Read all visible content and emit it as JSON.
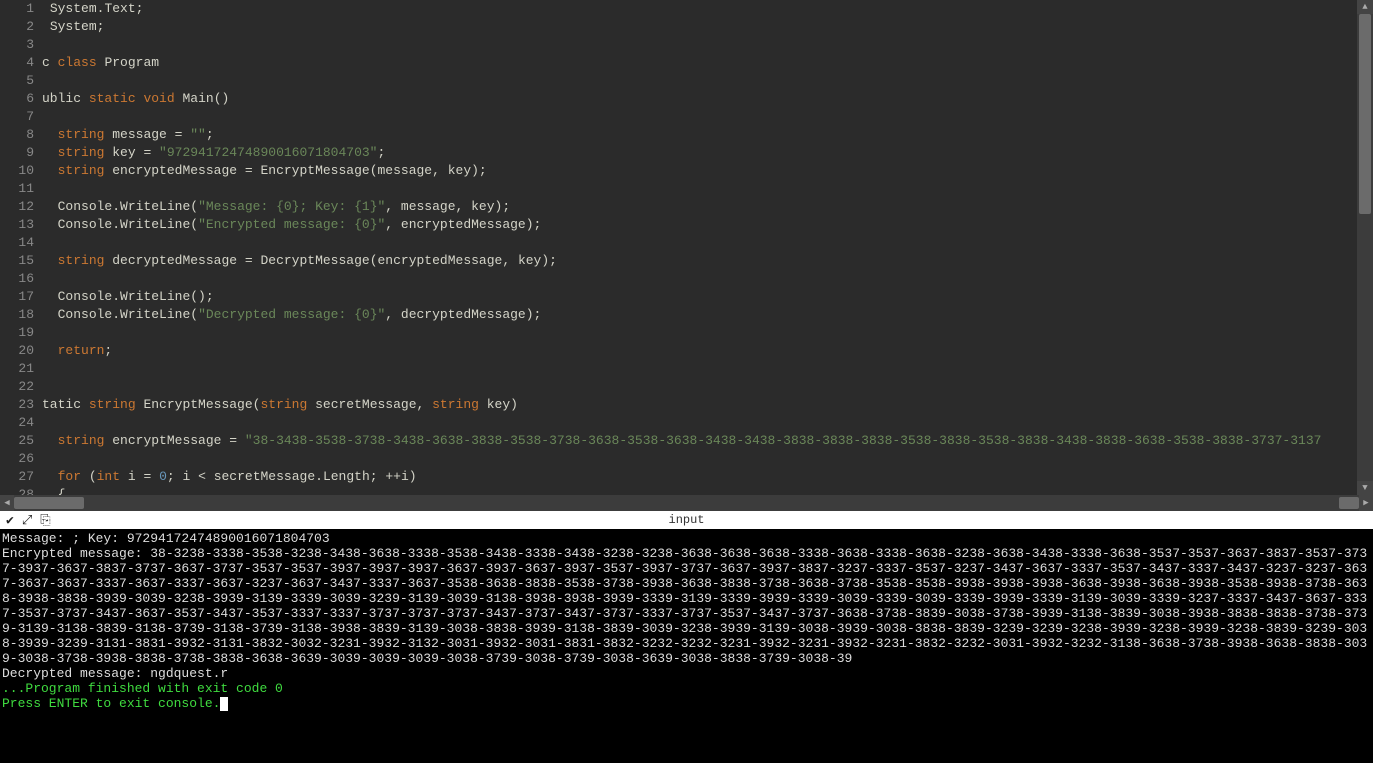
{
  "editor": {
    "lines": [
      [
        [
          " ",
          "pun"
        ],
        [
          "System",
          "cls"
        ],
        [
          ".",
          "pun"
        ],
        [
          "Text",
          "cls"
        ],
        [
          ";",
          "pun"
        ]
      ],
      [
        [
          " ",
          "pun"
        ],
        [
          "System",
          "cls"
        ],
        [
          ";",
          "pun"
        ]
      ],
      [],
      [
        [
          "c ",
          "id"
        ],
        [
          "class",
          "kw"
        ],
        [
          " ",
          "pun"
        ],
        [
          "Program",
          "cls"
        ]
      ],
      [],
      [
        [
          "ublic ",
          "id"
        ],
        [
          "static",
          "kw"
        ],
        [
          " ",
          "pun"
        ],
        [
          "void",
          "kw"
        ],
        [
          " ",
          "pun"
        ],
        [
          "Main",
          "fn"
        ],
        [
          "()",
          "pun"
        ]
      ],
      [],
      [
        [
          "  ",
          "pun"
        ],
        [
          "string",
          "type"
        ],
        [
          " ",
          "pun"
        ],
        [
          "message",
          "id"
        ],
        [
          " = ",
          "op"
        ],
        [
          "\"\"",
          "str"
        ],
        [
          ";",
          "pun"
        ]
      ],
      [
        [
          "  ",
          "pun"
        ],
        [
          "string",
          "type"
        ],
        [
          " ",
          "pun"
        ],
        [
          "key",
          "id"
        ],
        [
          " = ",
          "op"
        ],
        [
          "\"97294172474890016071804703\"",
          "str"
        ],
        [
          ";",
          "pun"
        ]
      ],
      [
        [
          "  ",
          "pun"
        ],
        [
          "string",
          "type"
        ],
        [
          " ",
          "pun"
        ],
        [
          "encryptedMessage",
          "id"
        ],
        [
          " = ",
          "op"
        ],
        [
          "EncryptMessage",
          "fn"
        ],
        [
          "(",
          "pun"
        ],
        [
          "message",
          "id"
        ],
        [
          ", ",
          "pun"
        ],
        [
          "key",
          "id"
        ],
        [
          ");",
          "pun"
        ]
      ],
      [],
      [
        [
          "  ",
          "pun"
        ],
        [
          "Console",
          "cls"
        ],
        [
          ".",
          "pun"
        ],
        [
          "WriteLine",
          "fn"
        ],
        [
          "(",
          "pun"
        ],
        [
          "\"Message: {0}; Key: {1}\"",
          "str"
        ],
        [
          ", ",
          "pun"
        ],
        [
          "message",
          "id"
        ],
        [
          ", ",
          "pun"
        ],
        [
          "key",
          "id"
        ],
        [
          ");",
          "pun"
        ]
      ],
      [
        [
          "  ",
          "pun"
        ],
        [
          "Console",
          "cls"
        ],
        [
          ".",
          "pun"
        ],
        [
          "WriteLine",
          "fn"
        ],
        [
          "(",
          "pun"
        ],
        [
          "\"Encrypted message: {0}\"",
          "str"
        ],
        [
          ", ",
          "pun"
        ],
        [
          "encryptedMessage",
          "id"
        ],
        [
          ");",
          "pun"
        ]
      ],
      [],
      [
        [
          "  ",
          "pun"
        ],
        [
          "string",
          "type"
        ],
        [
          " ",
          "pun"
        ],
        [
          "decryptedMessage",
          "id"
        ],
        [
          " = ",
          "op"
        ],
        [
          "DecryptMessage",
          "fn"
        ],
        [
          "(",
          "pun"
        ],
        [
          "encryptedMessage",
          "id"
        ],
        [
          ", ",
          "pun"
        ],
        [
          "key",
          "id"
        ],
        [
          ");",
          "pun"
        ]
      ],
      [],
      [
        [
          "  ",
          "pun"
        ],
        [
          "Console",
          "cls"
        ],
        [
          ".",
          "pun"
        ],
        [
          "WriteLine",
          "fn"
        ],
        [
          "();",
          "pun"
        ]
      ],
      [
        [
          "  ",
          "pun"
        ],
        [
          "Console",
          "cls"
        ],
        [
          ".",
          "pun"
        ],
        [
          "WriteLine",
          "fn"
        ],
        [
          "(",
          "pun"
        ],
        [
          "\"Decrypted message: {0}\"",
          "str"
        ],
        [
          ", ",
          "pun"
        ],
        [
          "decryptedMessage",
          "id"
        ],
        [
          ");",
          "pun"
        ]
      ],
      [],
      [
        [
          "  ",
          "pun"
        ],
        [
          "return",
          "kw"
        ],
        [
          ";",
          "pun"
        ]
      ],
      [],
      [],
      [
        [
          "tatic ",
          "id"
        ],
        [
          "string",
          "type"
        ],
        [
          " ",
          "pun"
        ],
        [
          "EncryptMessage",
          "fn"
        ],
        [
          "(",
          "pun"
        ],
        [
          "string",
          "type"
        ],
        [
          " ",
          "pun"
        ],
        [
          "secretMessage",
          "id"
        ],
        [
          ", ",
          "pun"
        ],
        [
          "string",
          "type"
        ],
        [
          " ",
          "pun"
        ],
        [
          "key",
          "id"
        ],
        [
          ")",
          "pun"
        ]
      ],
      [],
      [
        [
          "  ",
          "pun"
        ],
        [
          "string",
          "type"
        ],
        [
          " ",
          "pun"
        ],
        [
          "encryptMessage",
          "id"
        ],
        [
          " = ",
          "op"
        ],
        [
          "\"38-3438-3538-3738-3438-3638-3838-3538-3738-3638-3538-3638-3438-3438-3838-3838-3838-3538-3838-3538-3838-3438-3838-3638-3538-3838-3737-3137",
          "str"
        ]
      ],
      [],
      [
        [
          "  ",
          "pun"
        ],
        [
          "for",
          "kw"
        ],
        [
          " (",
          "pun"
        ],
        [
          "int",
          "type"
        ],
        [
          " ",
          "pun"
        ],
        [
          "i",
          "id"
        ],
        [
          " = ",
          "op"
        ],
        [
          "0",
          "num"
        ],
        [
          "; ",
          "pun"
        ],
        [
          "i",
          "id"
        ],
        [
          " < ",
          "op"
        ],
        [
          "secretMessage",
          "id"
        ],
        [
          ".",
          "pun"
        ],
        [
          "Length",
          "id"
        ],
        [
          "; ++",
          "op"
        ],
        [
          "i",
          "id"
        ],
        [
          ")",
          "pun"
        ]
      ],
      [
        [
          "  {",
          "pun"
        ]
      ]
    ]
  },
  "toolbar": {
    "title": "input"
  },
  "console": {
    "header": "Message: ; Key: 97294172474890016071804703",
    "encrypted_label": "Encrypted message: ",
    "encrypted_value": "38-3238-3338-3538-3238-3438-3638-3338-3538-3438-3338-3438-3238-3238-3638-3638-3638-3338-3638-3338-3638-3238-3638-3438-3338-3638-3537-3537-3637-3837-3537-3737-3937-3637-3837-3737-3637-3737-3537-3537-3937-3937-3937-3637-3937-3637-3937-3537-3937-3737-3637-3937-3837-3237-3337-3537-3237-3437-3637-3337-3537-3437-3337-3437-3237-3237-3637-3637-3637-3337-3637-3337-3637-3237-3637-3437-3337-3637-3538-3638-3838-3538-3738-3938-3638-3838-3738-3638-3738-3538-3538-3938-3938-3938-3638-3938-3638-3938-3538-3938-3738-3638-3938-3838-3939-3039-3238-3939-3139-3339-3039-3239-3139-3039-3138-3938-3938-3939-3339-3139-3339-3939-3339-3039-3339-3039-3339-3939-3339-3139-3039-3339-3237-3337-3437-3637-3337-3537-3737-3437-3637-3537-3437-3537-3337-3337-3737-3737-3737-3437-3737-3437-3737-3337-3737-3537-3437-3737-3638-3738-3839-3038-3738-3939-3138-3839-3038-3938-3838-3838-3738-3739-3139-3138-3839-3138-3739-3138-3739-3138-3938-3839-3139-3038-3838-3939-3138-3839-3039-3238-3939-3139-3038-3939-3038-3838-3839-3239-3239-3238-3939-3238-3939-3238-3839-3239-3038-3939-3239-3131-3831-3932-3131-3832-3032-3231-3932-3132-3031-3932-3031-3831-3832-3232-3232-3231-3932-3231-3932-3231-3832-3232-3031-3932-3232-3138-3638-3738-3938-3638-3838-3039-3038-3738-3938-3838-3738-3838-3638-3639-3039-3039-3039-3038-3739-3038-3739-3038-3639-3038-3838-3739-3038-39",
    "blank": "",
    "decrypted": "Decrypted message: ngdquest.r",
    "finished": "...Program finished with exit code 0",
    "prompt": "Press ENTER to exit console."
  }
}
